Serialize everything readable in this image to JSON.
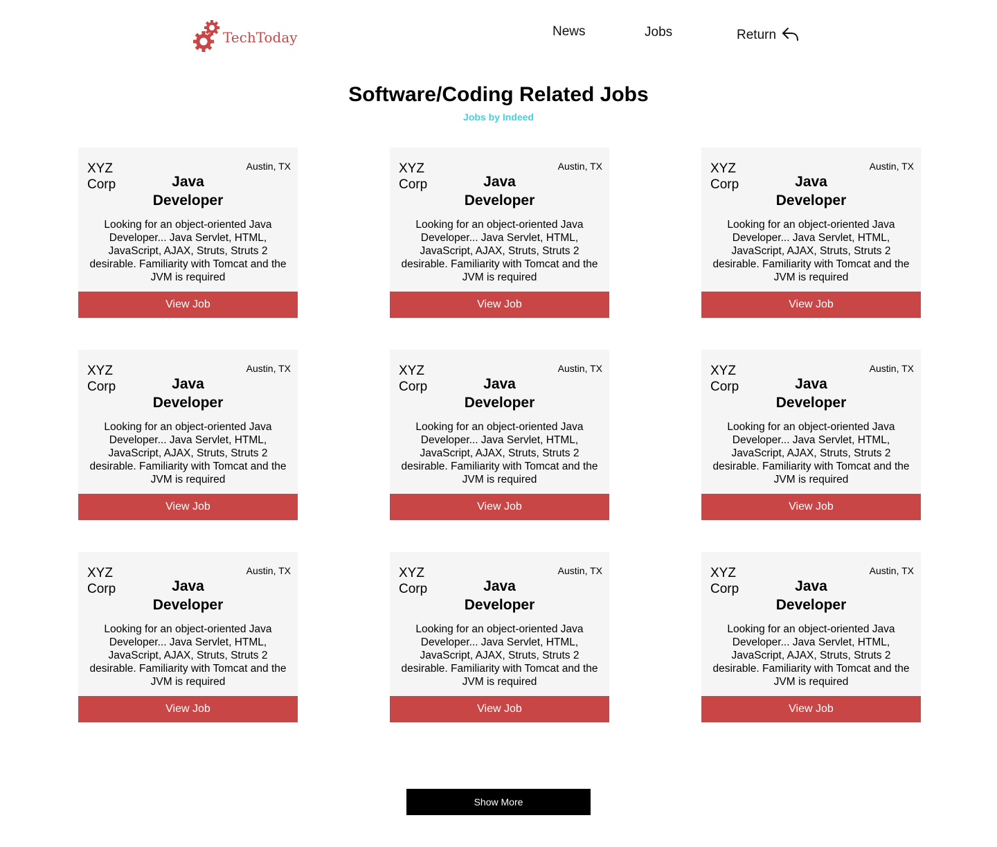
{
  "header": {
    "logo_text": "TechToday",
    "nav": {
      "news": "News",
      "jobs": "Jobs",
      "return": "Return"
    }
  },
  "main": {
    "title": "Software/Coding Related Jobs",
    "subtitle": "Jobs by Indeed",
    "jobs": [
      {
        "company": "XYZ Corp",
        "location": "Austin, TX",
        "title": "Java Developer",
        "description": "Looking for an object-oriented Java Developer... Java Servlet, HTML, JavaScript, AJAX, Struts, Struts 2 desirable. Familiarity with Tomcat and the JVM is required",
        "button": "View Job"
      },
      {
        "company": "XYZ Corp",
        "location": "Austin, TX",
        "title": "Java Developer",
        "description": "Looking for an object-oriented Java Developer... Java Servlet, HTML, JavaScript, AJAX, Struts, Struts 2 desirable. Familiarity with Tomcat and the JVM is required",
        "button": "View Job"
      },
      {
        "company": "XYZ Corp",
        "location": "Austin, TX",
        "title": "Java Developer",
        "description": "Looking for an object-oriented Java Developer... Java Servlet, HTML, JavaScript, AJAX, Struts, Struts 2 desirable. Familiarity with Tomcat and the JVM is required",
        "button": "View Job"
      },
      {
        "company": "XYZ Corp",
        "location": "Austin, TX",
        "title": "Java Developer",
        "description": "Looking for an object-oriented Java Developer... Java Servlet, HTML, JavaScript, AJAX, Struts, Struts 2 desirable. Familiarity with Tomcat and the JVM is required",
        "button": "View Job"
      },
      {
        "company": "XYZ Corp",
        "location": "Austin, TX",
        "title": "Java Developer",
        "description": "Looking for an object-oriented Java Developer... Java Servlet, HTML, JavaScript, AJAX, Struts, Struts 2 desirable. Familiarity with Tomcat and the JVM is required",
        "button": "View Job"
      },
      {
        "company": "XYZ Corp",
        "location": "Austin, TX",
        "title": "Java Developer",
        "description": "Looking for an object-oriented Java Developer... Java Servlet, HTML, JavaScript, AJAX, Struts, Struts 2 desirable. Familiarity with Tomcat and the JVM is required",
        "button": "View Job"
      },
      {
        "company": "XYZ Corp",
        "location": "Austin, TX",
        "title": "Java Developer",
        "description": "Looking for an object-oriented Java Developer... Java Servlet, HTML, JavaScript, AJAX, Struts, Struts 2 desirable. Familiarity with Tomcat and the JVM is required",
        "button": "View Job"
      },
      {
        "company": "XYZ Corp",
        "location": "Austin, TX",
        "title": "Java Developer",
        "description": "Looking for an object-oriented Java Developer... Java Servlet, HTML, JavaScript, AJAX, Struts, Struts 2 desirable. Familiarity with Tomcat and the JVM is required",
        "button": "View Job"
      },
      {
        "company": "XYZ Corp",
        "location": "Austin, TX",
        "title": "Java Developer",
        "description": "Looking for an object-oriented Java Developer... Java Servlet, HTML, JavaScript, AJAX, Struts, Struts 2 desirable. Familiarity with Tomcat and the JVM is required",
        "button": "View Job"
      }
    ],
    "show_more": "Show More"
  },
  "icons": {
    "logo": "gears-icon",
    "return": "reply-arrow-icon"
  },
  "colors": {
    "brand": "#c94646",
    "subtitle": "#3fd3e0",
    "card_bg": "#f5f5f5",
    "show_more_bg": "#000000"
  }
}
